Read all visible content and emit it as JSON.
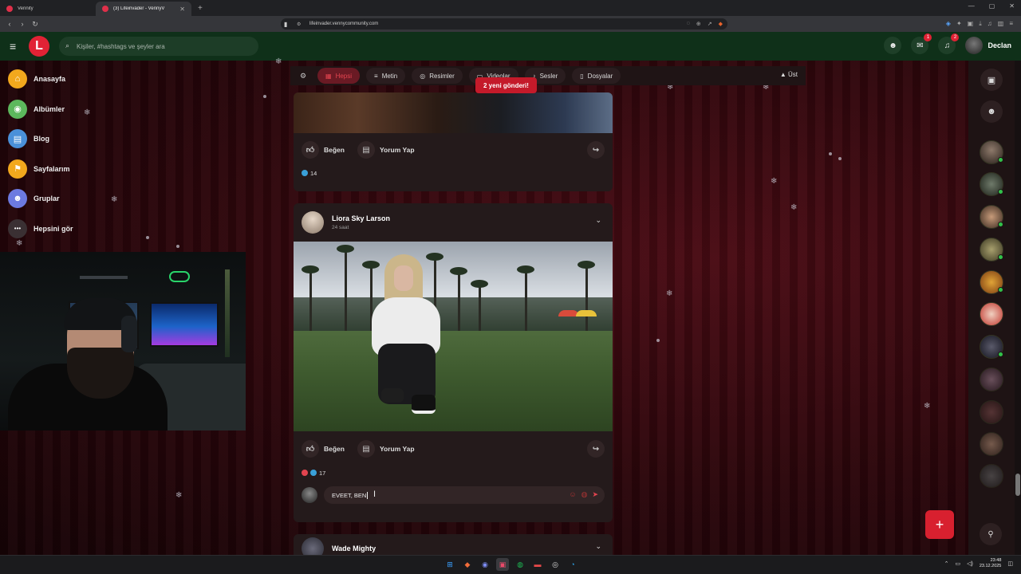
{
  "colors": {
    "brand": "#e12235",
    "header_bg": "#0f3019",
    "page_bg": "#2b060b",
    "card_bg": "#241a1b",
    "online": "#31c24a"
  },
  "browser": {
    "tabs": [
      {
        "title": "Vennity",
        "active": false
      },
      {
        "title": "(3) Lifeinvader - VennyV",
        "active": true
      }
    ],
    "new_tab": "+",
    "url": "lifeinvader.vennycommunity.com",
    "window_controls": [
      "—",
      "▢",
      "✕"
    ]
  },
  "header": {
    "logo_letter": "L",
    "search_placeholder": "Kişiler, #hashtags ve şeyler ara",
    "messages_badge": "1",
    "notifications_badge": "2",
    "user_name": "Declan"
  },
  "sidebar": {
    "items": [
      {
        "label": "Anasayfa",
        "icon": "home-icon",
        "color": "#f2a81d",
        "glyph": "⌂"
      },
      {
        "label": "Albümler",
        "icon": "album-icon",
        "color": "#5cb85c",
        "glyph": "◉"
      },
      {
        "label": "Blog",
        "icon": "blog-icon",
        "color": "#4a90d9",
        "glyph": "▤"
      },
      {
        "label": "Sayfalarım",
        "icon": "flag-icon",
        "color": "#f2a81d",
        "glyph": "⚑"
      },
      {
        "label": "Gruplar",
        "icon": "groups-icon",
        "color": "#6c7ae0",
        "glyph": "☻"
      },
      {
        "label": "Hepsini gör",
        "icon": "more-icon",
        "color": "#3a3033",
        "glyph": "•••"
      }
    ]
  },
  "filters": {
    "chips": [
      {
        "label": "Hepsi",
        "icon": "all-icon",
        "glyph": "▦",
        "active": true
      },
      {
        "label": "Metin",
        "icon": "text-icon",
        "glyph": "≡",
        "active": false
      },
      {
        "label": "Resimler",
        "icon": "camera-icon",
        "glyph": "◎",
        "active": false
      },
      {
        "label": "Videolar",
        "icon": "video-icon",
        "glyph": "▭",
        "active": false
      },
      {
        "label": "Sesler",
        "icon": "music-icon",
        "glyph": "♪",
        "active": false
      },
      {
        "label": "Dosyalar",
        "icon": "file-icon",
        "glyph": "▯",
        "active": false
      }
    ],
    "top_label": "Üst",
    "new_posts_banner": "2 yeni gönderi!"
  },
  "posts": [
    {
      "like_label": "Beğen",
      "comment_label": "Yorum Yap",
      "reaction_count": "14"
    },
    {
      "author": "Liora Sky Larson",
      "time": "24 saat",
      "like_label": "Beğen",
      "comment_label": "Yorum Yap",
      "reaction_count": "17",
      "comment_draft": "EVEET, BEN"
    },
    {
      "author": "Wade Mighty"
    }
  ],
  "rail": {
    "fab_label": "+"
  },
  "taskbar": {
    "time": "23:48",
    "date": "23.12.2025"
  }
}
